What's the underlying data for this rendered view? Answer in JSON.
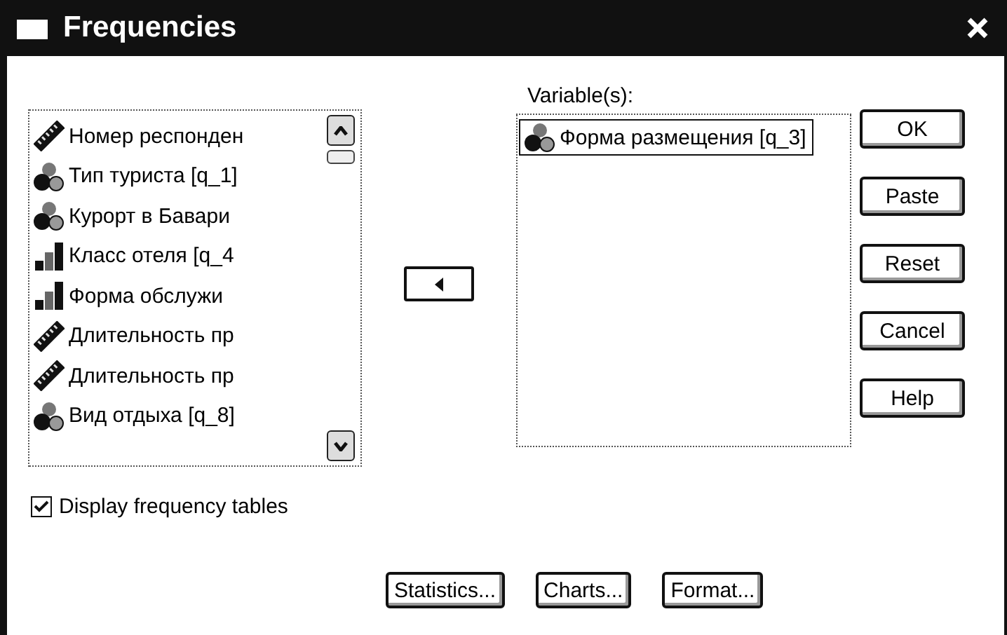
{
  "window": {
    "title": "Frequencies"
  },
  "source_list": {
    "items": [
      {
        "label": "Номер респонден",
        "kind": "scale"
      },
      {
        "label": "Тип туриста [q_1]",
        "kind": "nominal"
      },
      {
        "label": "Курорт в Бавари",
        "kind": "nominal"
      },
      {
        "label": "Класс отеля [q_4",
        "kind": "ordinal"
      },
      {
        "label": "Форма обслужи",
        "kind": "ordinal"
      },
      {
        "label": "Длительность пр",
        "kind": "scale"
      },
      {
        "label": "Длительность пр",
        "kind": "scale"
      },
      {
        "label": "Вид отдыха [q_8]",
        "kind": "nominal"
      }
    ]
  },
  "target": {
    "label": "Variable(s):",
    "items": [
      {
        "label": "Форма размещения [q_3]",
        "kind": "nominal",
        "selected": true
      }
    ]
  },
  "side_buttons": [
    "OK",
    "Paste",
    "Reset",
    "Cancel",
    "Help"
  ],
  "display_tables": {
    "label": "Display frequency tables",
    "checked": true
  },
  "bottom_buttons": [
    "Statistics...",
    "Charts...",
    "Format..."
  ]
}
